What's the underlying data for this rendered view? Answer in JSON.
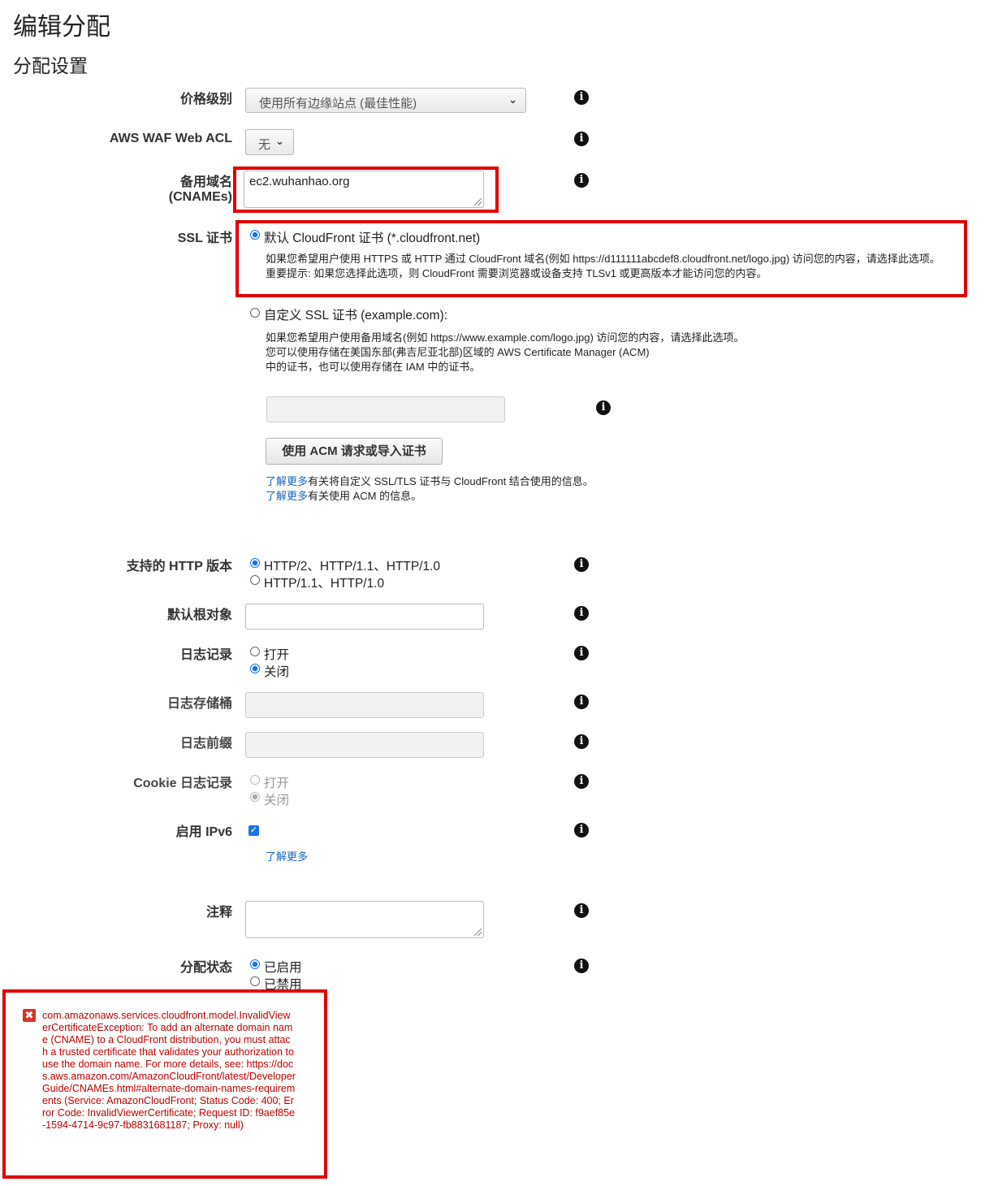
{
  "page": {
    "title": "编辑分配",
    "section_title": "分配设置"
  },
  "fields": {
    "price_class": {
      "label": "价格级别",
      "value": "使用所有边缘站点 (最佳性能)"
    },
    "waf": {
      "label": "AWS WAF Web ACL",
      "value": "无"
    },
    "cnames": {
      "label_line1": "备用域名",
      "label_line2": "(CNAMEs)",
      "value": "ec2.wuhanhao.org"
    },
    "ssl": {
      "label": "SSL 证书",
      "default_option": "默认 CloudFront 证书 (*.cloudfront.net)",
      "default_desc_line1": "如果您希望用户使用 HTTPS 或 HTTP 通过 CloudFront 域名(例如 https://d111111abcdef8.cloudfront.net/logo.jpg) 访问您的内容，请选择此选项。",
      "default_desc_line2": "重要提示: 如果您选择此选项，则 CloudFront 需要浏览器或设备支持 TLSv1 或更高版本才能访问您的内容。",
      "custom_option": "自定义 SSL 证书 (example.com):",
      "custom_desc_line1": "如果您希望用户使用备用域名(例如 https://www.example.com/logo.jpg) 访问您的内容，请选择此选项。",
      "custom_desc_line2": "您可以使用存储在美国东部(弗吉尼亚北部)区域的 AWS Certificate Manager (ACM)",
      "custom_desc_line3": "中的证书，也可以使用存储在 IAM 中的证书。",
      "acm_button": "使用 ACM 请求或导入证书",
      "learn_more_1_link": "了解更多",
      "learn_more_1_text": "有关将自定义 SSL/TLS 证书与 CloudFront 结合使用的信息。",
      "learn_more_2_link": "了解更多",
      "learn_more_2_text": "有关使用 ACM 的信息。",
      "selected": "default"
    },
    "http_version": {
      "label": "支持的 HTTP 版本",
      "option1": "HTTP/2、HTTP/1.1、HTTP/1.0",
      "option2": "HTTP/1.1、HTTP/1.0",
      "selected": "option1"
    },
    "default_root": {
      "label": "默认根对象",
      "value": ""
    },
    "logging": {
      "label": "日志记录",
      "on": "打开",
      "off": "关闭",
      "selected": "off"
    },
    "log_bucket": {
      "label": "日志存储桶",
      "value": ""
    },
    "log_prefix": {
      "label": "日志前缀",
      "value": ""
    },
    "cookie_logging": {
      "label": "Cookie 日志记录",
      "on": "打开",
      "off": "关闭",
      "selected": "off",
      "disabled": true
    },
    "ipv6": {
      "label": "启用 IPv6",
      "checked": true,
      "learn_more": "了解更多"
    },
    "comment": {
      "label": "注释",
      "value": ""
    },
    "state": {
      "label": "分配状态",
      "enabled": "已启用",
      "disabled": "已禁用",
      "selected": "enabled"
    }
  },
  "error": {
    "icon": "error-x-icon",
    "message": "com.amazonaws.services.cloudfront.model.InvalidViewerCertificateException: To add an alternate domain name (CNAME) to a CloudFront distribution, you must attach a trusted certificate that validates your authorization to use the domain name. For more details, see: https://docs.aws.amazon.com/AmazonCloudFront/latest/DeveloperGuide/CNAMEs.html#alternate-domain-names-requirements (Service: AmazonCloudFront; Status Code: 400; Error Code: InvalidViewerCertificate; Request ID: f9aef85e-1594-4714-9c97-fb8831681187; Proxy: null)"
  },
  "colors": {
    "highlight_border": "#e00000",
    "link": "#1565c0",
    "error_text": "#c00000",
    "radio_selected": "#1a73e8"
  }
}
